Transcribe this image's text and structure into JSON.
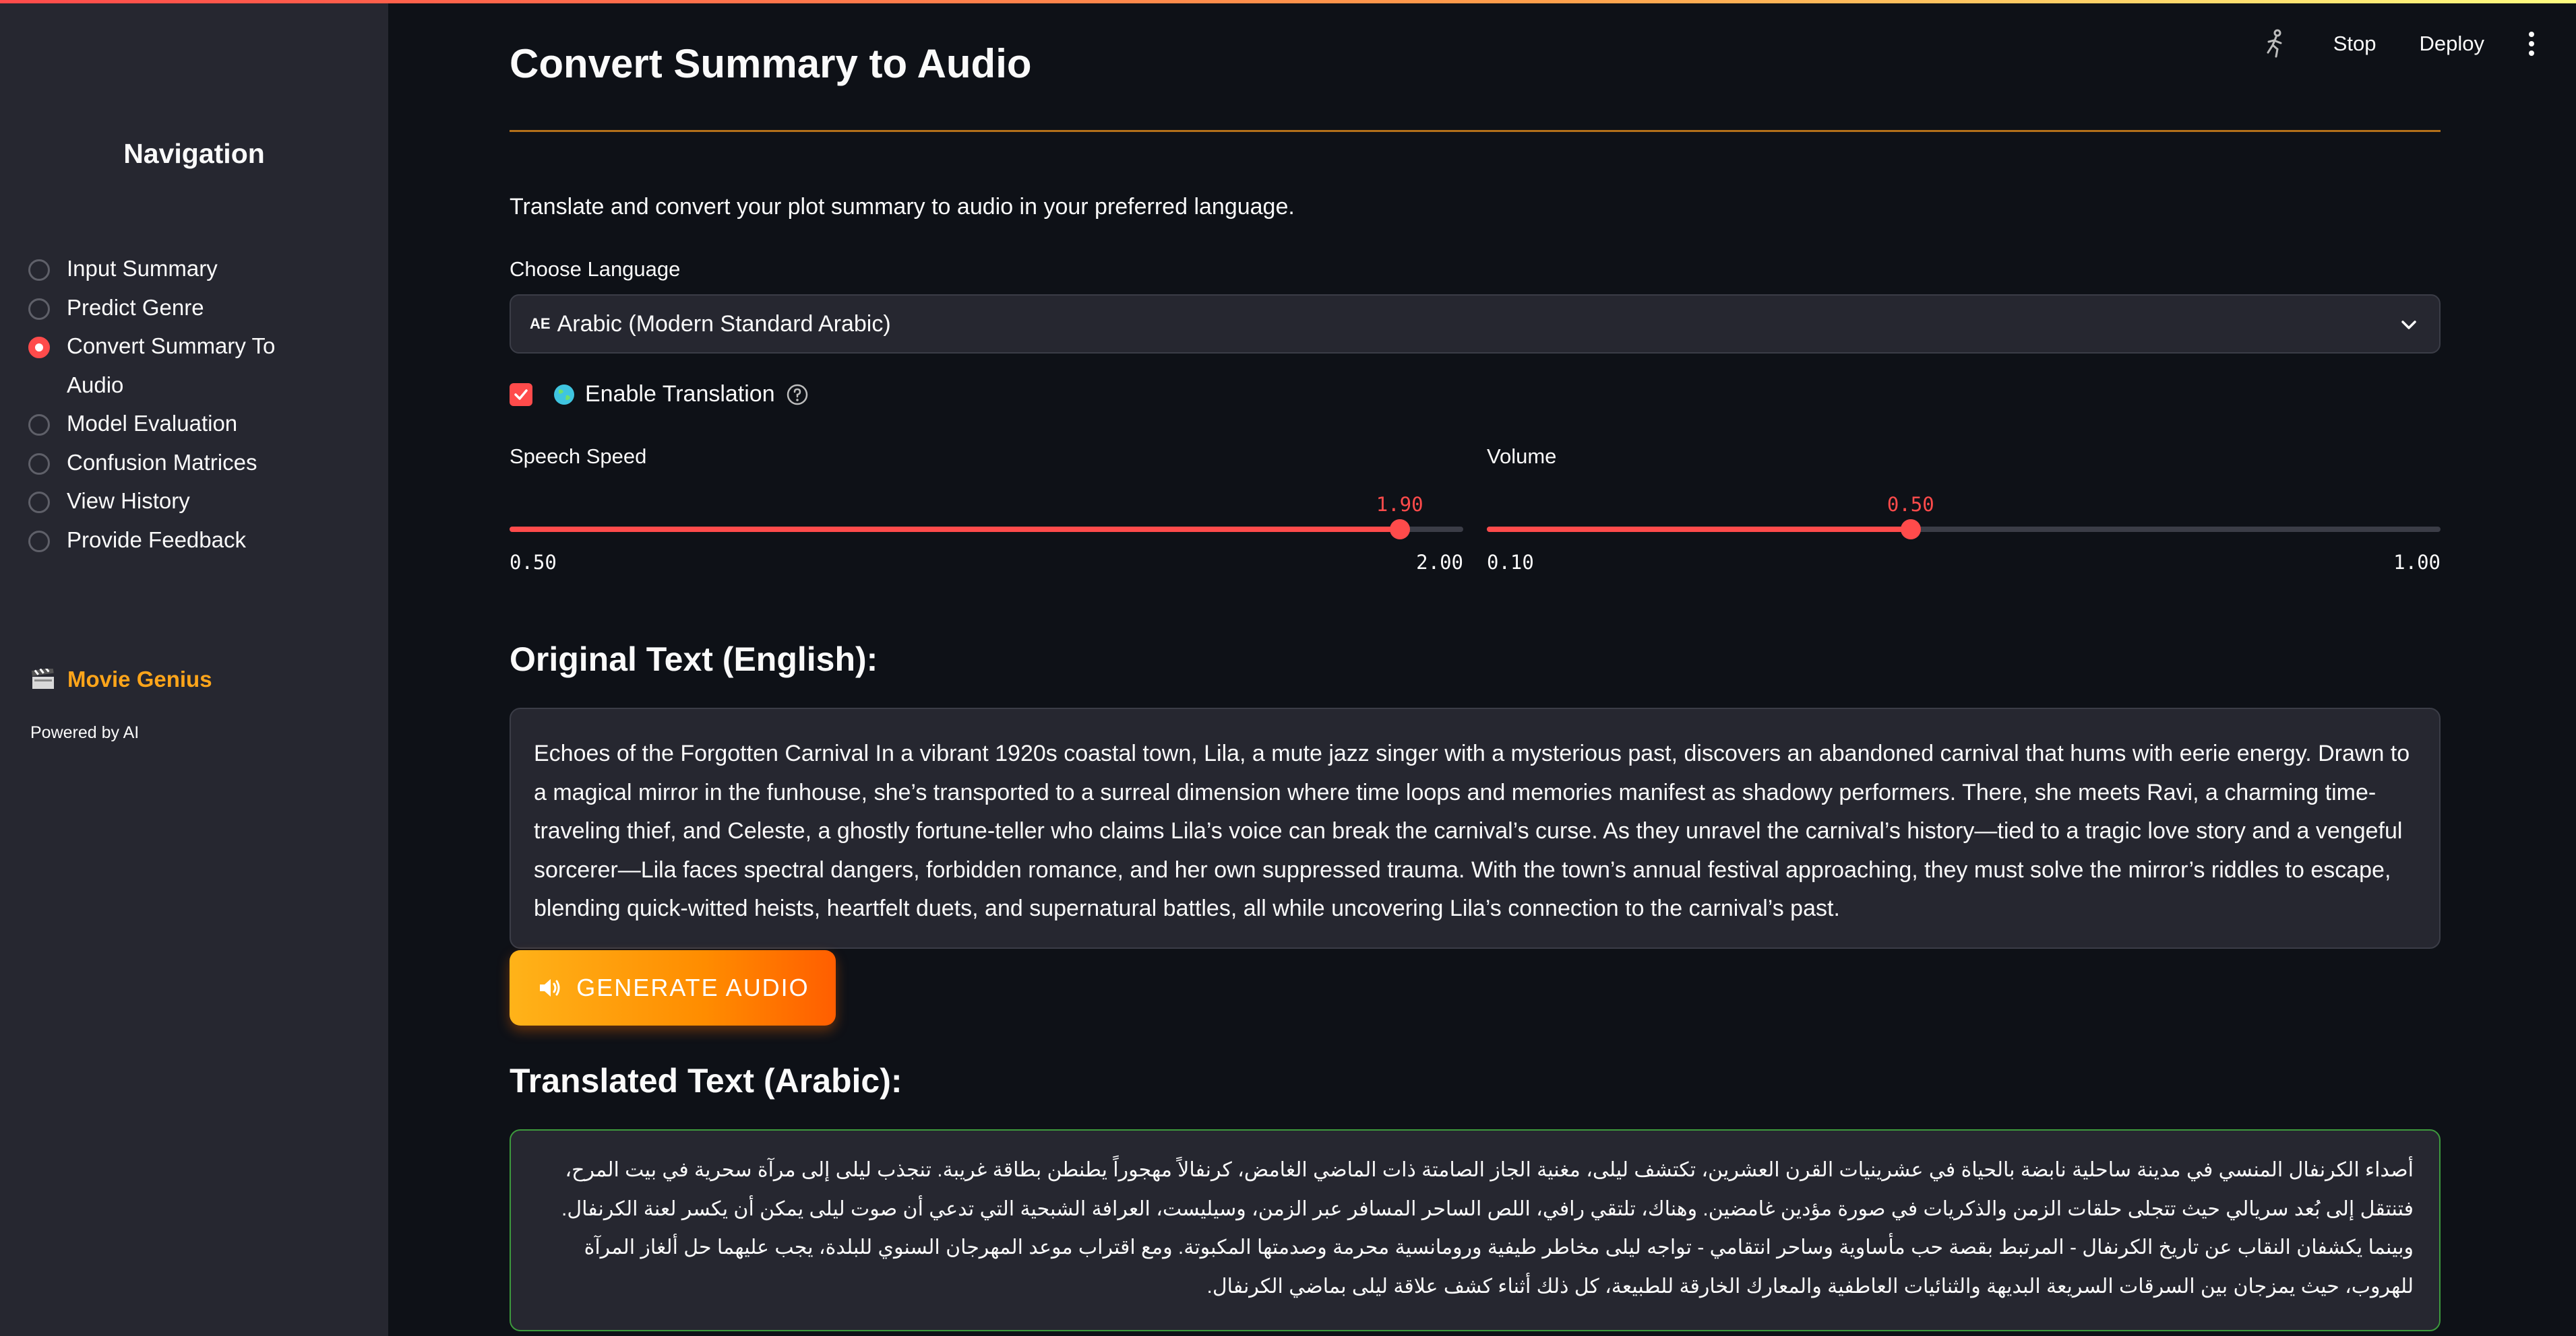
{
  "sidebar": {
    "title": "Navigation",
    "items": [
      {
        "label": "Input Summary",
        "selected": false
      },
      {
        "label": "Predict Genre",
        "selected": false
      },
      {
        "label": "Convert Summary To",
        "label2": "Audio",
        "selected": true
      },
      {
        "label": "Model Evaluation",
        "selected": false
      },
      {
        "label": "Confusion Matrices",
        "selected": false
      },
      {
        "label": "View History",
        "selected": false
      },
      {
        "label": "Provide Feedback",
        "selected": false
      }
    ],
    "brand": "Movie Genius",
    "powered": "Powered by AI"
  },
  "header": {
    "stop": "Stop",
    "deploy": "Deploy"
  },
  "main": {
    "title": "Convert Summary to Audio",
    "intro": "Translate and convert your plot summary to audio in your preferred language.",
    "language_label": "Choose Language",
    "language_flag": "AE",
    "language_value": "Arabic (Modern Standard Arabic)",
    "enable_translation": "Enable Translation",
    "translation_checked": true,
    "speech": {
      "label": "Speech Speed",
      "value": "1.90",
      "min": "0.50",
      "max": "2.00",
      "fraction": 0.9333
    },
    "volume": {
      "label": "Volume",
      "value": "0.50",
      "min": "0.10",
      "max": "1.00",
      "fraction": 0.4444
    },
    "original_heading": "Original Text (English):",
    "original_text": "Echoes of the Forgotten Carnival In a vibrant 1920s coastal town, Lila, a mute jazz singer with a mysterious past, discovers an abandoned carnival that hums with eerie energy. Drawn to a magical mirror in the funhouse, she’s transported to a surreal dimension where time loops and memories manifest as shadowy performers. There, she meets Ravi, a charming time-traveling thief, and Celeste, a ghostly fortune-teller who claims Lila’s voice can break the carnival’s curse. As they unravel the carnival’s history—tied to a tragic love story and a vengeful sorcerer—Lila faces spectral dangers, forbidden romance, and her own suppressed trauma. With the town’s annual festival approaching, they must solve the mirror’s riddles to escape, blending quick-witted heists, heartfelt duets, and supernatural battles, all while uncovering Lila’s connection to the carnival’s past.",
    "generate_button": "GENERATE AUDIO",
    "translated_heading": "Translated Text (Arabic):",
    "translated_text": "أصداء الكرنفال المنسي في مدينة ساحلية نابضة بالحياة في عشرينيات القرن العشرين، تكتشف ليلى، مغنية الجاز الصامتة ذات الماضي الغامض، كرنفالاً مهجوراً يطنطن بطاقة غريبة. تنجذب ليلى إلى مرآة سحرية في بيت المرح، فتنتقل إلى بُعد سريالي حيث تتجلى حلقات الزمن والذكريات في صورة مؤدين غامضين. وهناك، تلتقي رافي، اللص الساحر المسافر عبر الزمن، وسيليست، العرافة الشبحية التي تدعي أن صوت ليلى يمكن أن يكسر لعنة الكرنفال. وبينما يكشفان النقاب عن تاريخ الكرنفال - المرتبط بقصة حب مأساوية وساحر انتقامي - تواجه ليلى مخاطر طيفية ورومانسية محرمة وصدمتها المكبوتة. ومع اقتراب موعد المهرجان السنوي للبلدة، يجب عليهما حل ألغاز المرآة للهروب، حيث يمزجان بين السرقات السريعة البديهة والثنائيات العاطفية والمعارك الخارقة للطبيعة، كل ذلك أثناء كشف علاقة ليلى بماضي الكرنفال."
  },
  "colors": {
    "accent": "#ff4b4b",
    "brand": "#ffa51a",
    "sidebar_bg": "#262730",
    "page_bg": "#0e1117",
    "translated_border": "#3d9a3d"
  },
  "icons": [
    "running-man-icon",
    "kebab-menu-icon",
    "chevron-down-icon",
    "globe-icon",
    "help-circle-icon",
    "speaker-icon",
    "clapperboard-icon"
  ]
}
